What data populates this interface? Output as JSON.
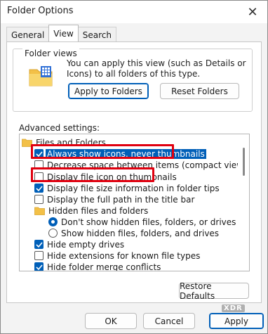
{
  "window": {
    "title": "Folder Options",
    "close_glyph": "✕"
  },
  "tabs": [
    {
      "label": "General",
      "active": false
    },
    {
      "label": "View",
      "active": true
    },
    {
      "label": "Search",
      "active": false
    }
  ],
  "folder_views": {
    "group_label": "Folder views",
    "description": "You can apply this view (such as Details or Icons) to all folders of this type.",
    "apply_button": "Apply to Folders",
    "reset_button": "Reset Folders"
  },
  "advanced": {
    "label": "Advanced settings:",
    "items": [
      {
        "kind": "folder",
        "label": "Files and Folders"
      },
      {
        "kind": "checkbox",
        "checked": true,
        "label": "Always show icons, never thumbnails",
        "highlighted": true
      },
      {
        "kind": "checkbox",
        "checked": false,
        "label": "Decrease space between items (compact view)"
      },
      {
        "kind": "checkbox",
        "checked": false,
        "label": "Display file icon on thumbnails"
      },
      {
        "kind": "checkbox",
        "checked": true,
        "label": "Display file size information in folder tips"
      },
      {
        "kind": "checkbox",
        "checked": false,
        "label": "Display the full path in the title bar"
      },
      {
        "kind": "folder",
        "label": "Hidden files and folders"
      },
      {
        "kind": "radio",
        "checked": true,
        "label": "Don't show hidden files, folders, or drives"
      },
      {
        "kind": "radio",
        "checked": false,
        "label": "Show hidden files, folders, and drives"
      },
      {
        "kind": "checkbox",
        "checked": true,
        "label": "Hide empty drives"
      },
      {
        "kind": "checkbox",
        "checked": false,
        "label": "Hide extensions for known file types"
      },
      {
        "kind": "checkbox",
        "checked": true,
        "label": "Hide folder merge conflicts"
      }
    ]
  },
  "restore_defaults_button": "Restore Defaults",
  "footer": {
    "ok": "OK",
    "cancel": "Cancel",
    "apply": "Apply"
  },
  "watermark": "XDR",
  "colors": {
    "accent": "#005fb8",
    "annotation_red": "#e0000f",
    "folder_yellow": "#f3c047"
  }
}
